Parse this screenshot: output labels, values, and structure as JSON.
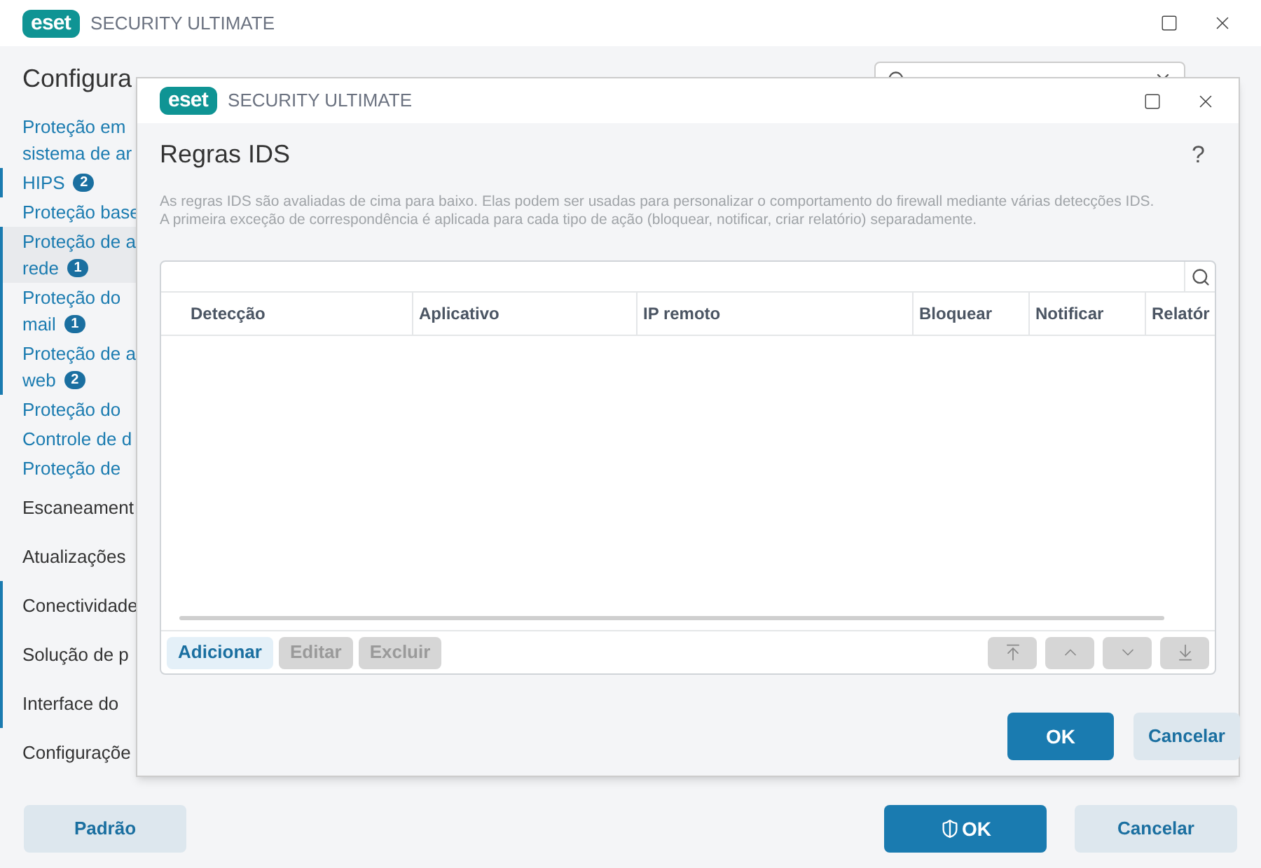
{
  "window": {
    "brand": "eset",
    "title": "SECURITY ULTIMATE"
  },
  "page": {
    "heading": "Configura"
  },
  "sidebar": {
    "items": [
      {
        "lines": [
          "Proteção em",
          "sistema de ar"
        ],
        "kind": "link",
        "marked": false,
        "selected": false
      },
      {
        "lines": [
          "HIPS"
        ],
        "badge": "2",
        "kind": "link",
        "marked": true,
        "selected": false
      },
      {
        "lines": [
          "Proteção base"
        ],
        "kind": "link",
        "marked": false,
        "selected": false
      },
      {
        "lines": [
          "Proteção de a",
          "rede"
        ],
        "badge": "1",
        "kind": "link",
        "marked": true,
        "selected": true
      },
      {
        "lines": [
          "Proteção do",
          "mail"
        ],
        "badge": "1",
        "kind": "link",
        "marked": true,
        "selected": false
      },
      {
        "lines": [
          "Proteção de a",
          "web"
        ],
        "badge": "2",
        "kind": "link",
        "marked": true,
        "selected": false
      },
      {
        "lines": [
          "Proteção do"
        ],
        "kind": "link",
        "marked": false,
        "selected": false
      },
      {
        "lines": [
          "Controle de d"
        ],
        "kind": "link",
        "marked": false,
        "selected": false
      },
      {
        "lines": [
          "Proteção de"
        ],
        "kind": "link",
        "marked": false,
        "selected": false
      },
      {
        "lines": [
          "Escaneament"
        ],
        "kind": "section",
        "marked": false,
        "selected": false
      },
      {
        "lines": [
          "Atualizações"
        ],
        "kind": "section",
        "marked": false,
        "selected": false
      },
      {
        "lines": [
          "Conectividade"
        ],
        "kind": "section",
        "marked": true,
        "selected": false
      },
      {
        "lines": [
          "Solução de p"
        ],
        "kind": "section",
        "marked": true,
        "selected": false
      },
      {
        "lines": [
          "Interface do"
        ],
        "kind": "section",
        "marked": true,
        "selected": false
      },
      {
        "lines": [
          "Configuraçõe"
        ],
        "kind": "section",
        "marked": false,
        "selected": false
      }
    ]
  },
  "footer": {
    "default_button": "Padrão",
    "ok_button": "OK",
    "cancel_button": "Cancelar"
  },
  "dialog": {
    "brand": "eset",
    "title": "SECURITY ULTIMATE",
    "heading": "Regras IDS",
    "help": "?",
    "description": [
      "As regras IDS são avaliadas de cima para baixo. Elas podem ser usadas para personalizar o comportamento do firewall mediante várias detecções IDS.",
      "A primeira exceção de correspondência é aplicada para cada tipo de ação (bloquear, notificar, criar relatório) separadamente."
    ],
    "table": {
      "columns": [
        "Detecção",
        "Aplicativo",
        "IP remoto",
        "Bloquear",
        "Notificar",
        "Relatór"
      ]
    },
    "actions": [
      {
        "label": "Adicionar",
        "disabled": false
      },
      {
        "label": "Editar",
        "disabled": true
      },
      {
        "label": "Excluir",
        "disabled": true
      }
    ],
    "move_buttons": [
      {
        "kind": "top",
        "disabled": true
      },
      {
        "kind": "up",
        "disabled": true
      },
      {
        "kind": "down",
        "disabled": true
      },
      {
        "kind": "bottom",
        "disabled": true
      }
    ],
    "ok_button": "OK",
    "cancel_button": "Cancelar"
  }
}
